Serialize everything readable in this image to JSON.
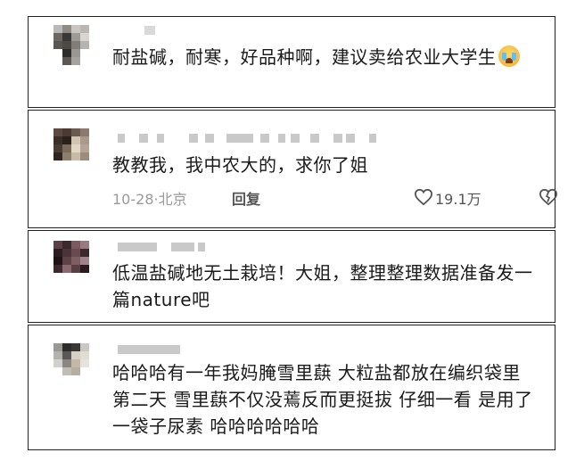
{
  "comments": [
    {
      "text": "耐盐碱，耐寒，好品种啊，建议卖给农业大学生",
      "emoji": "crying-face"
    },
    {
      "text": "教教我，我中农大的，求你了姐",
      "date": "10-28",
      "location": "北京",
      "reply_label": "回复",
      "likes": "19.1万"
    },
    {
      "text": "低温盐碱地无土栽培！大姐，整理整理数据准备发一篇nature吧"
    },
    {
      "text": "哈哈哈有一年我妈腌雪里蕻 大粒盐都放在编织袋里 第二天 雪里蕻不仅没蔫反而更挺拔 仔细一看 是用了一袋子尿素 哈哈哈哈哈哈"
    }
  ],
  "meta_separator": "·",
  "colors": {
    "border": "#222222",
    "text": "#1a1a1a",
    "meta": "#9a9a9a"
  }
}
